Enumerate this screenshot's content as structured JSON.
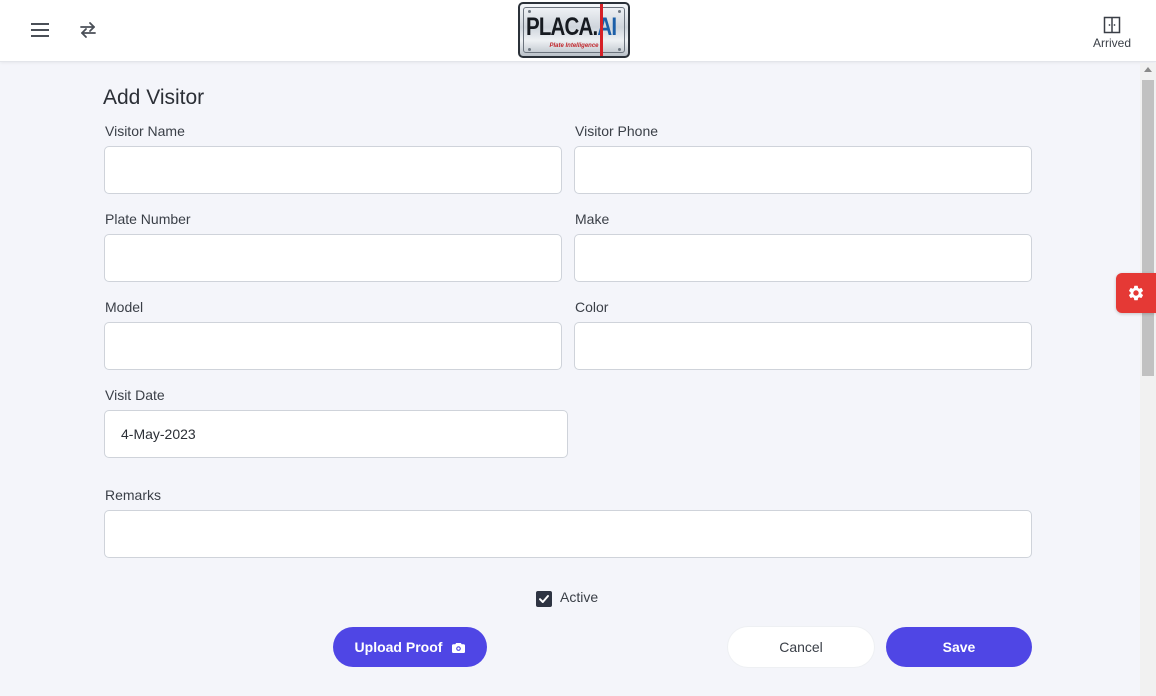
{
  "header": {
    "logo": {
      "main": "PLACA.",
      "accent": "AI",
      "tagline": "Plate Intelligence"
    },
    "arrived_label": "Arrived"
  },
  "form": {
    "title": "Add Visitor",
    "fields": {
      "visitor_name": {
        "label": "Visitor Name",
        "value": ""
      },
      "visitor_phone": {
        "label": "Visitor Phone",
        "value": ""
      },
      "plate_number": {
        "label": "Plate Number",
        "value": ""
      },
      "make": {
        "label": "Make",
        "value": ""
      },
      "model": {
        "label": "Model",
        "value": ""
      },
      "color": {
        "label": "Color",
        "value": ""
      },
      "visit_date": {
        "label": "Visit Date",
        "value": "4-May-2023"
      },
      "remarks": {
        "label": "Remarks",
        "value": ""
      }
    },
    "active": {
      "label": "Active",
      "checked": true
    },
    "buttons": {
      "upload_proof": "Upload Proof",
      "cancel": "Cancel",
      "save": "Save"
    }
  },
  "icons": {
    "menu": "hamburger-menu-icon",
    "swap": "swap-arrows-icon",
    "arrived": "door-icon",
    "settings": "gear-icon",
    "camera": "camera-icon",
    "check": "checkmark-icon"
  },
  "colors": {
    "primary": "#4f46e5",
    "settings_tab": "#e53935",
    "background": "#f4f5fa",
    "checkbox": "#2e3442"
  }
}
